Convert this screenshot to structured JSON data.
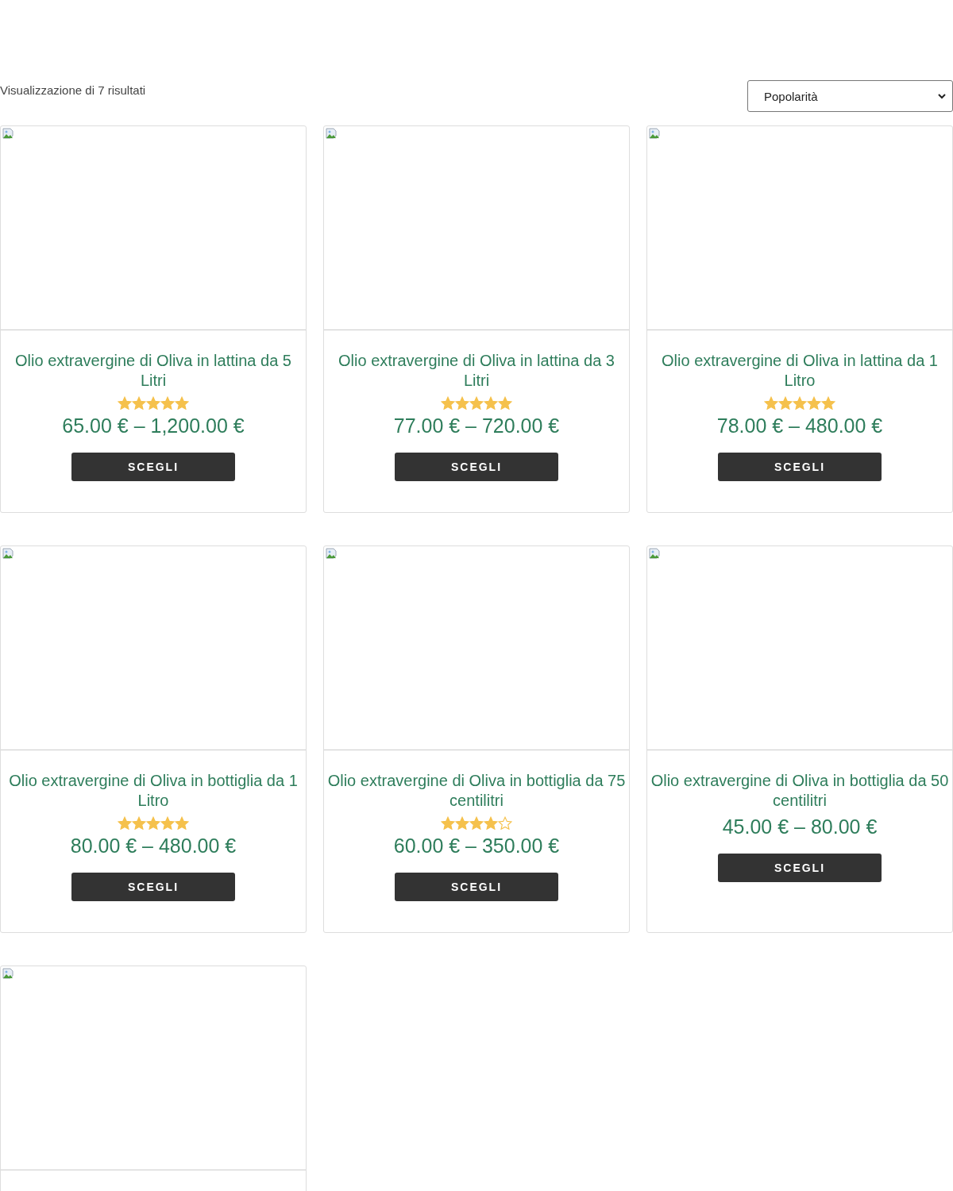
{
  "result_count": "Visualizzazione di 7 risultati",
  "sort": {
    "value": "Popolarità"
  },
  "products": [
    {
      "kind": "full",
      "title": "Olio extravergine di Oliva in lattina da 5 Litri",
      "stars": 5,
      "price": "65.00 € – 1,200.00 €",
      "button": "SCEGLI"
    },
    {
      "kind": "full",
      "title": "Olio extravergine di Oliva in lattina da 3 Litri",
      "stars": 5,
      "price": "77.00 € – 720.00 €",
      "button": "SCEGLI"
    },
    {
      "kind": "full",
      "title": "Olio extravergine di Oliva in lattina da 1 Litro",
      "stars": 5,
      "price": "78.00 € – 480.00 €",
      "button": "SCEGLI"
    },
    {
      "kind": "full",
      "title": "Olio extravergine di Oliva in bottiglia da 1 Litro",
      "stars": 5,
      "price": "80.00 € – 480.00 €",
      "button": "SCEGLI"
    },
    {
      "kind": "full",
      "title": "Olio extravergine di Oliva in bottiglia da 75 centilitri",
      "stars": 4,
      "price": "60.00 € – 350.00 €",
      "button": "SCEGLI"
    },
    {
      "kind": "full",
      "title": "Olio extravergine di Oliva in bottiglia da 50 centilitri",
      "price": "45.00 € – 80.00 €",
      "button": "SCEGLI"
    },
    {
      "kind": "image_only"
    }
  ]
}
